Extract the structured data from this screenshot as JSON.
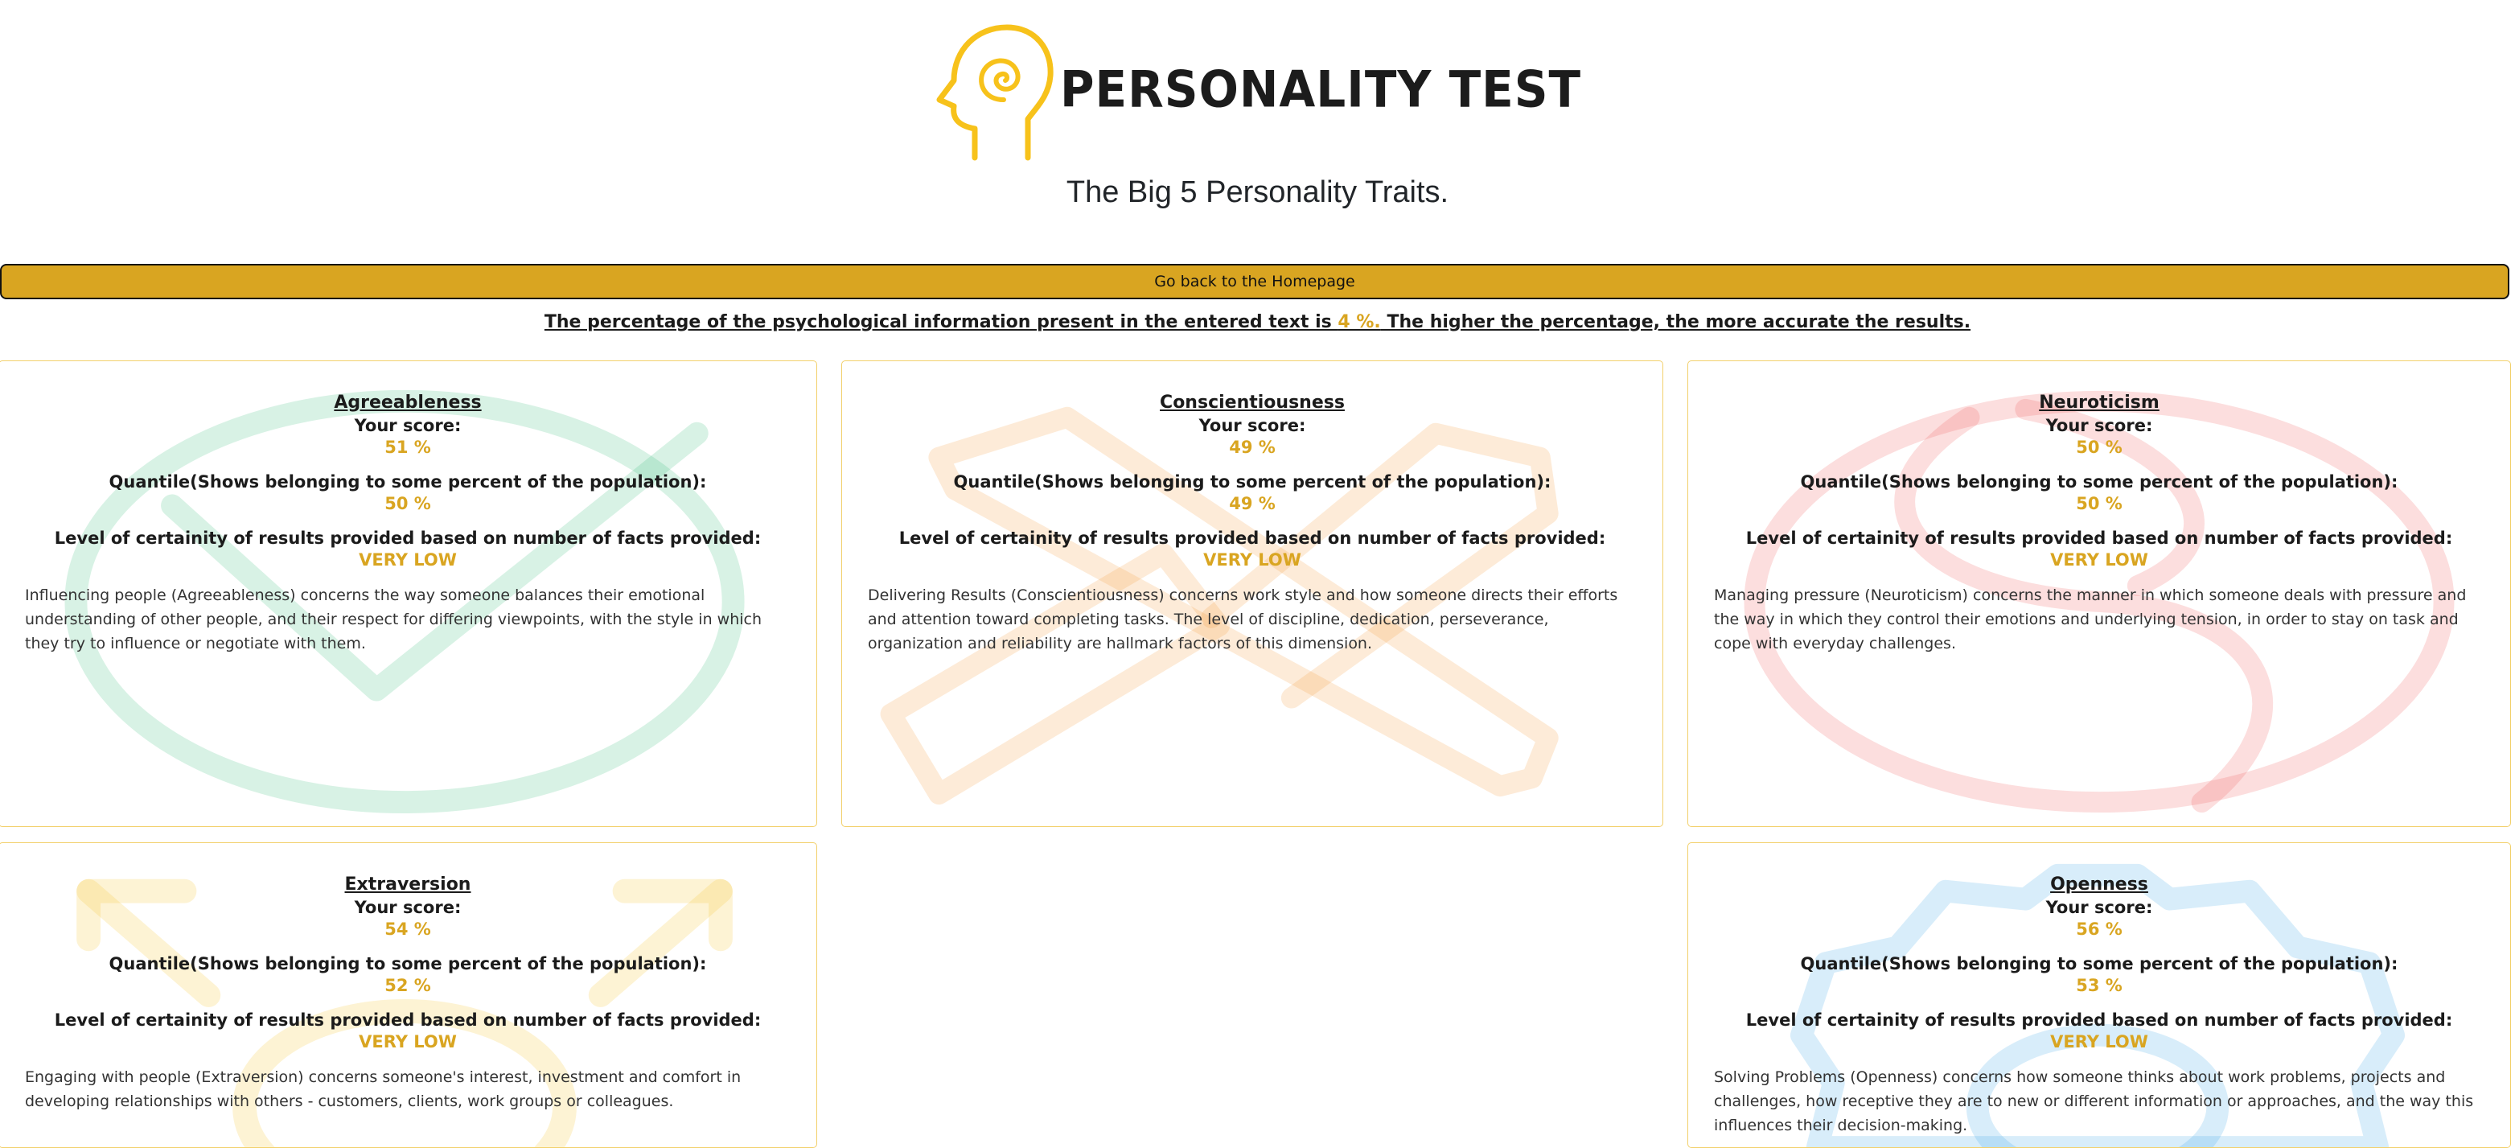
{
  "header": {
    "logo_text": "PERSONALITY TEST",
    "subtitle": "The Big 5 Personality Traits."
  },
  "home_button": "Go back to the Homepage",
  "accuracy": {
    "before": "The percentage of the psychological information present in the entered text is ",
    "percent": "4 %.",
    "after": " The higher the percentage, the more accurate the results."
  },
  "labels": {
    "score": "Your score:",
    "quantile": "Quantile(Shows belonging to some percent of the population):",
    "certainty": "Level of certainity of results provided based on number of facts provided:"
  },
  "colors": {
    "accent": "#d9a521",
    "card_border": "#f2d06b",
    "agreeableness": "#3cbf7e",
    "conscientiousness": "#f79a3b",
    "neuroticism": "#ee5a5a",
    "extraversion": "#f8c93a",
    "openness": "#3aa7e6"
  },
  "traits": {
    "agreeableness": {
      "title": "Agreeableness",
      "score": "51 %",
      "quantile": "50 %",
      "certainty": "VERY LOW",
      "icon": "checkmark-circle-icon",
      "description": "Influencing people (Agreeableness) concerns the way someone balances their emotional understanding of other people, and their respect for differing viewpoints, with the style in which they try to influence or negotiate with them."
    },
    "conscientiousness": {
      "title": "Conscientiousness",
      "score": "49 %",
      "quantile": "49 %",
      "certainty": "VERY LOW",
      "icon": "crossed-tools-icon",
      "description": "Delivering Results (Conscientiousness) concerns work style and how someone directs their efforts and attention toward completing tasks. The level of discipline, dedication, perseverance, organization and reliability are hallmark factors of this dimension."
    },
    "neuroticism": {
      "title": "Neuroticism",
      "score": "50 %",
      "quantile": "50 %",
      "certainty": "VERY LOW",
      "icon": "yin-yang-icon",
      "description": "Managing pressure (Neuroticism) concerns the manner in which someone deals with pressure and the way in which they control their emotions and underlying tension, in order to stay on task and cope with everyday challenges."
    },
    "extraversion": {
      "title": "Extraversion",
      "score": "54 %",
      "quantile": "52 %",
      "certainty": "VERY LOW",
      "icon": "expand-arrows-icon",
      "description": "Engaging with people (Extraversion) concerns someone's interest, investment and comfort in developing relationships with others - customers, clients, work groups or colleagues."
    },
    "openness": {
      "title": "Openness",
      "score": "56 %",
      "quantile": "53 %",
      "certainty": "VERY LOW",
      "icon": "gear-icon",
      "description": "Solving Problems (Openness) concerns how someone thinks about work problems, projects and challenges, how receptive they are to new or different information or approaches, and the way this influences their decision-making."
    }
  }
}
